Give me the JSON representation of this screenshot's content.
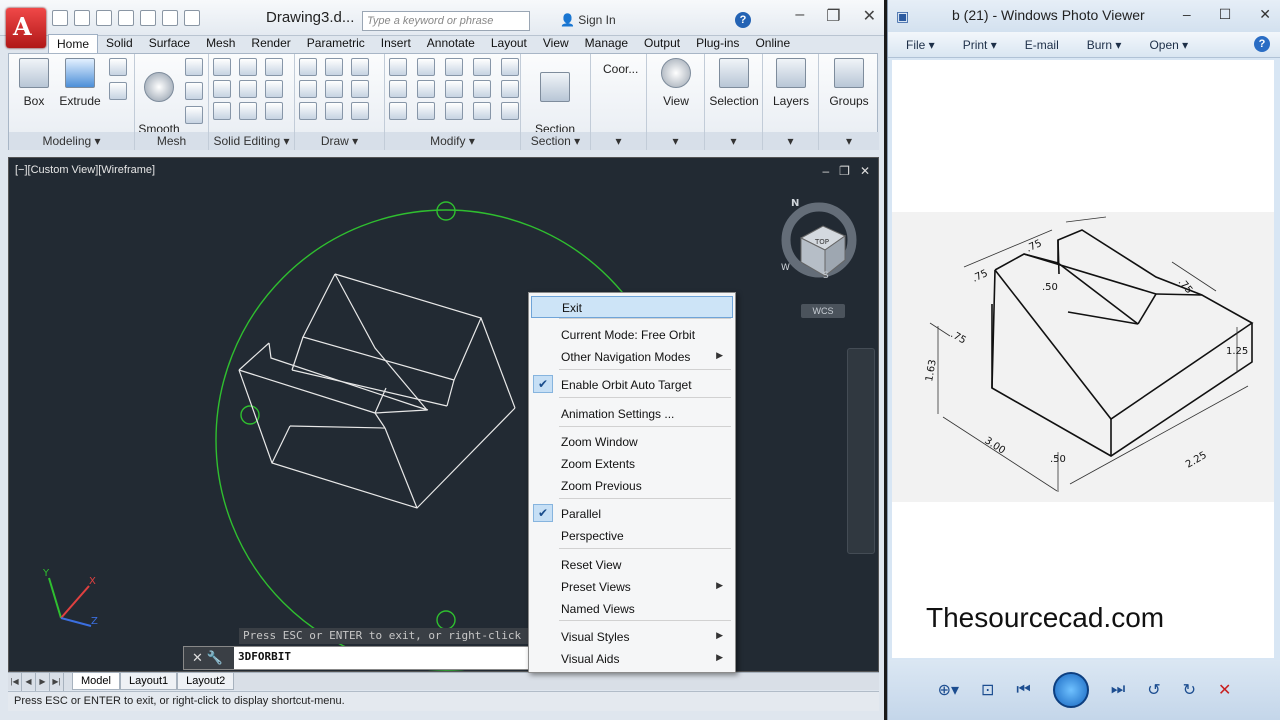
{
  "acad": {
    "doc_title": "Drawing3.d...",
    "search_placeholder": "Type a keyword or phrase",
    "sign_in": "Sign In",
    "help": "?",
    "tabs": [
      "Home",
      "Solid",
      "Surface",
      "Mesh",
      "Render",
      "Parametric",
      "Insert",
      "Annotate",
      "Layout",
      "View",
      "Manage",
      "Output",
      "Plug-ins",
      "Online"
    ],
    "active_tab": "Home",
    "ribbon": {
      "box": "Box",
      "extrude": "Extrude",
      "smooth_object": "Smooth\nObject",
      "section_plane": "Section\nPlane",
      "coord": "Coor...",
      "view": "View",
      "selection": "Selection",
      "layers": "Layers",
      "groups": "Groups",
      "groups_labels": {
        "modeling": "Modeling ▾",
        "mesh": "Mesh",
        "solid_editing": "Solid Editing ▾",
        "draw": "Draw ▾",
        "modify": "Modify ▾",
        "section": "Section ▾"
      }
    },
    "viewport_label": "[−][Custom View][Wireframe]",
    "wcs": "WCS",
    "viewcube_top": "TOP",
    "compass_n": "N",
    "compass_w": "W",
    "compass_s": "S",
    "cmd_prompt": "Press ESC or ENTER to exit, or right-click t",
    "cmd_input": "3DFORBIT",
    "layout_tabs": [
      "Model",
      "Layout1",
      "Layout2"
    ],
    "status_text": "Press ESC or ENTER to exit, or right-click to display shortcut-menu."
  },
  "context_menu": {
    "items": [
      {
        "label": "Exit",
        "highlight": true
      },
      {
        "label": "Current Mode: Free Orbit"
      },
      {
        "label": "Other Navigation Modes",
        "submenu": true
      },
      {
        "label": "Enable Orbit Auto Target",
        "checked": true
      },
      {
        "label": "Animation Settings ..."
      },
      {
        "label": "Zoom Window"
      },
      {
        "label": "Zoom Extents"
      },
      {
        "label": "Zoom Previous"
      },
      {
        "label": "Parallel",
        "checked": true
      },
      {
        "label": "Perspective"
      },
      {
        "label": "Reset View"
      },
      {
        "label": "Preset Views",
        "submenu": true
      },
      {
        "label": "Named Views"
      },
      {
        "label": "Visual Styles",
        "submenu": true
      },
      {
        "label": "Visual Aids",
        "submenu": true
      }
    ]
  },
  "photo_viewer": {
    "title": "b (21) - Windows Photo Viewer",
    "menu": [
      "File ▾",
      "Print ▾",
      "E-mail",
      "Burn ▾",
      "Open ▾"
    ],
    "watermark": "Thesourcecad.com",
    "dims": {
      "d75a": ".75",
      "d75b": ".75",
      "d75c": ".75",
      "d75d": ".75",
      "d50a": ".50",
      "d50b": ".50",
      "d163": "1.63",
      "d125": "1.25",
      "d300": "3.00",
      "d225": "2.25"
    }
  },
  "colors": {
    "viewport_bg": "#222a33",
    "orbit_green": "#2fbf2f",
    "menu_highlight": "#cde4f7"
  }
}
